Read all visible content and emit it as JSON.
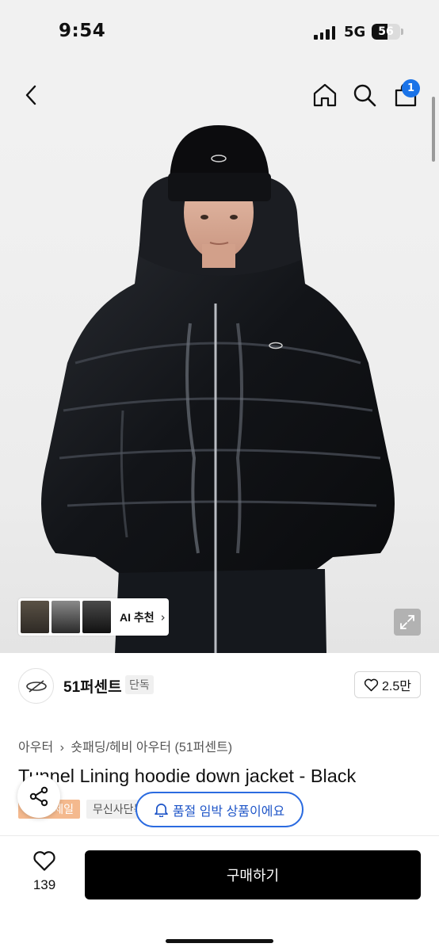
{
  "status_bar": {
    "time": "9:54",
    "network": "5G",
    "battery": "56",
    "battery_level": 0.56
  },
  "header": {
    "back_icon": "chevron-left-icon",
    "home_icon": "home-icon",
    "search_icon": "search-icon",
    "cart_icon": "shopping-bag-icon",
    "cart_badge": "1"
  },
  "hero": {
    "ai_label": "AI 추천",
    "ai_chevron": "›",
    "expand_icon": "expand-icon"
  },
  "brand": {
    "name": "51퍼센트",
    "tag": "단독",
    "likes": "2.5만"
  },
  "product": {
    "breadcrumb_1": "아우터",
    "breadcrumb_sep": "›",
    "breadcrumb_2": "숏패딩/헤비 아우터 (51퍼센트)",
    "title": "Tunnel Lining hoodie down jacket - Black",
    "tag_sale": "세일",
    "tag_exclusive": "무신사단독"
  },
  "toast": {
    "text": "품절 임박 상품이에요"
  },
  "bottom_bar": {
    "wish_count": "139",
    "buy_label": "구매하기"
  },
  "colors": {
    "accent": "#2b6be0",
    "badge": "#1a73e8",
    "sale_tag": "#f4b98e",
    "buy_button": "#000000"
  }
}
